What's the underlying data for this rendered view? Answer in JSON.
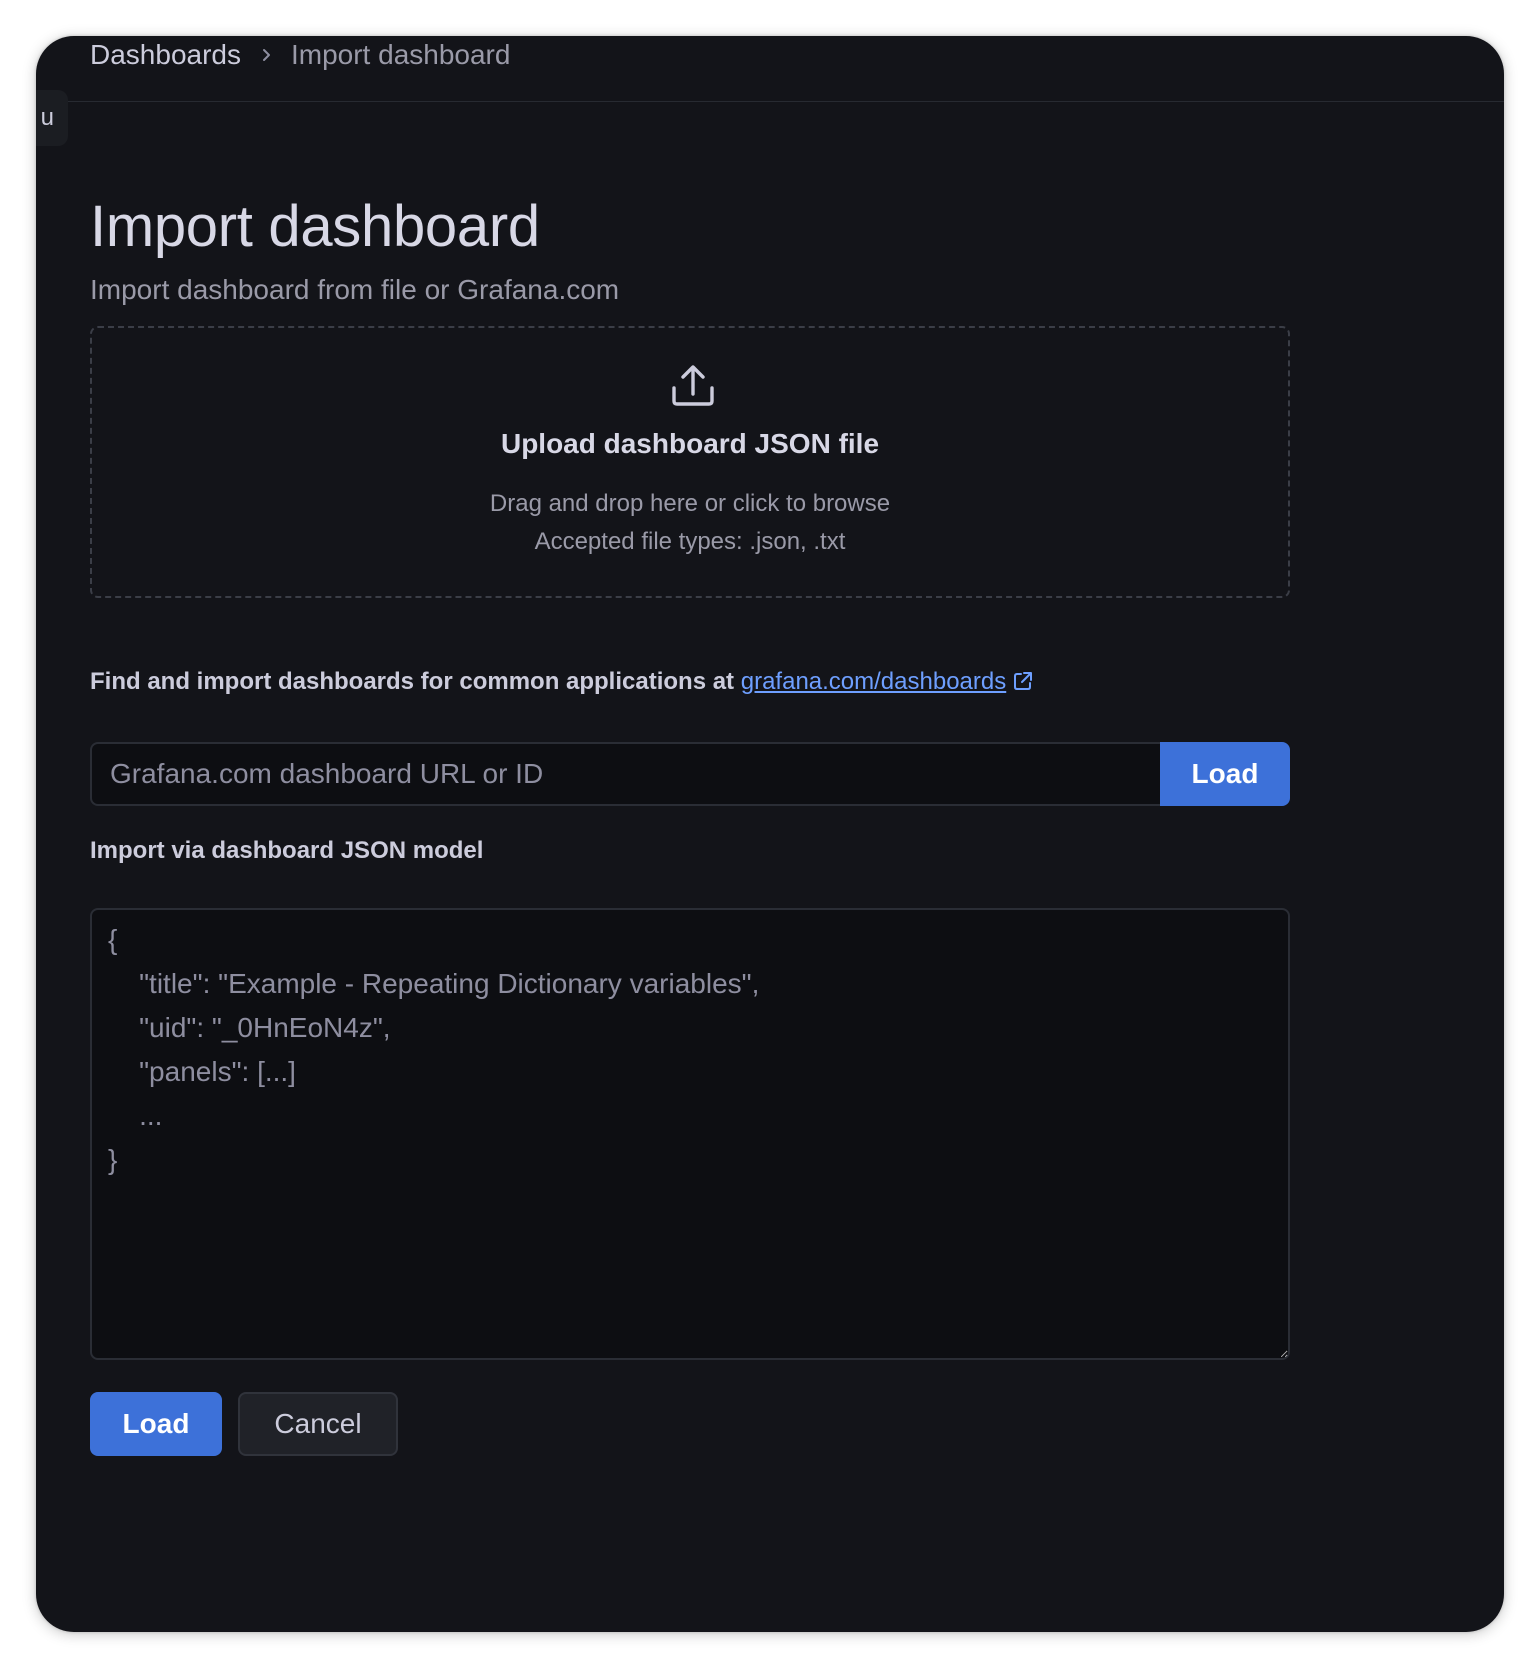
{
  "breadcrumb": {
    "parent": "Dashboards",
    "current": "Import dashboard"
  },
  "menu_tab": {
    "label": "u"
  },
  "page": {
    "title": "Import dashboard",
    "subtitle": "Import dashboard from file or Grafana.com"
  },
  "upload": {
    "icon": "upload-icon",
    "title": "Upload dashboard JSON file",
    "hint": "Drag and drop here or click to browse",
    "accepted": "Accepted file types: .json, .txt"
  },
  "grafana_com": {
    "label": "Find and import dashboards for common applications at",
    "link_text": "grafana.com/dashboards",
    "link_icon": "external-link-icon",
    "input_placeholder": "Grafana.com dashboard URL or ID",
    "load_label": "Load"
  },
  "json_model": {
    "label": "Import via dashboard JSON model",
    "placeholder": "{\n    \"title\": \"Example - Repeating Dictionary variables\",\n    \"uid\": \"_0HnEoN4z\",\n    \"panels\": [...]\n    ...\n}"
  },
  "actions": {
    "load_label": "Load",
    "cancel_label": "Cancel"
  },
  "colors": {
    "background": "#131419",
    "primary": "#3d71d9",
    "link": "#6e9fff",
    "text": "#ccccdc",
    "muted_text": "#9a9aa8"
  }
}
